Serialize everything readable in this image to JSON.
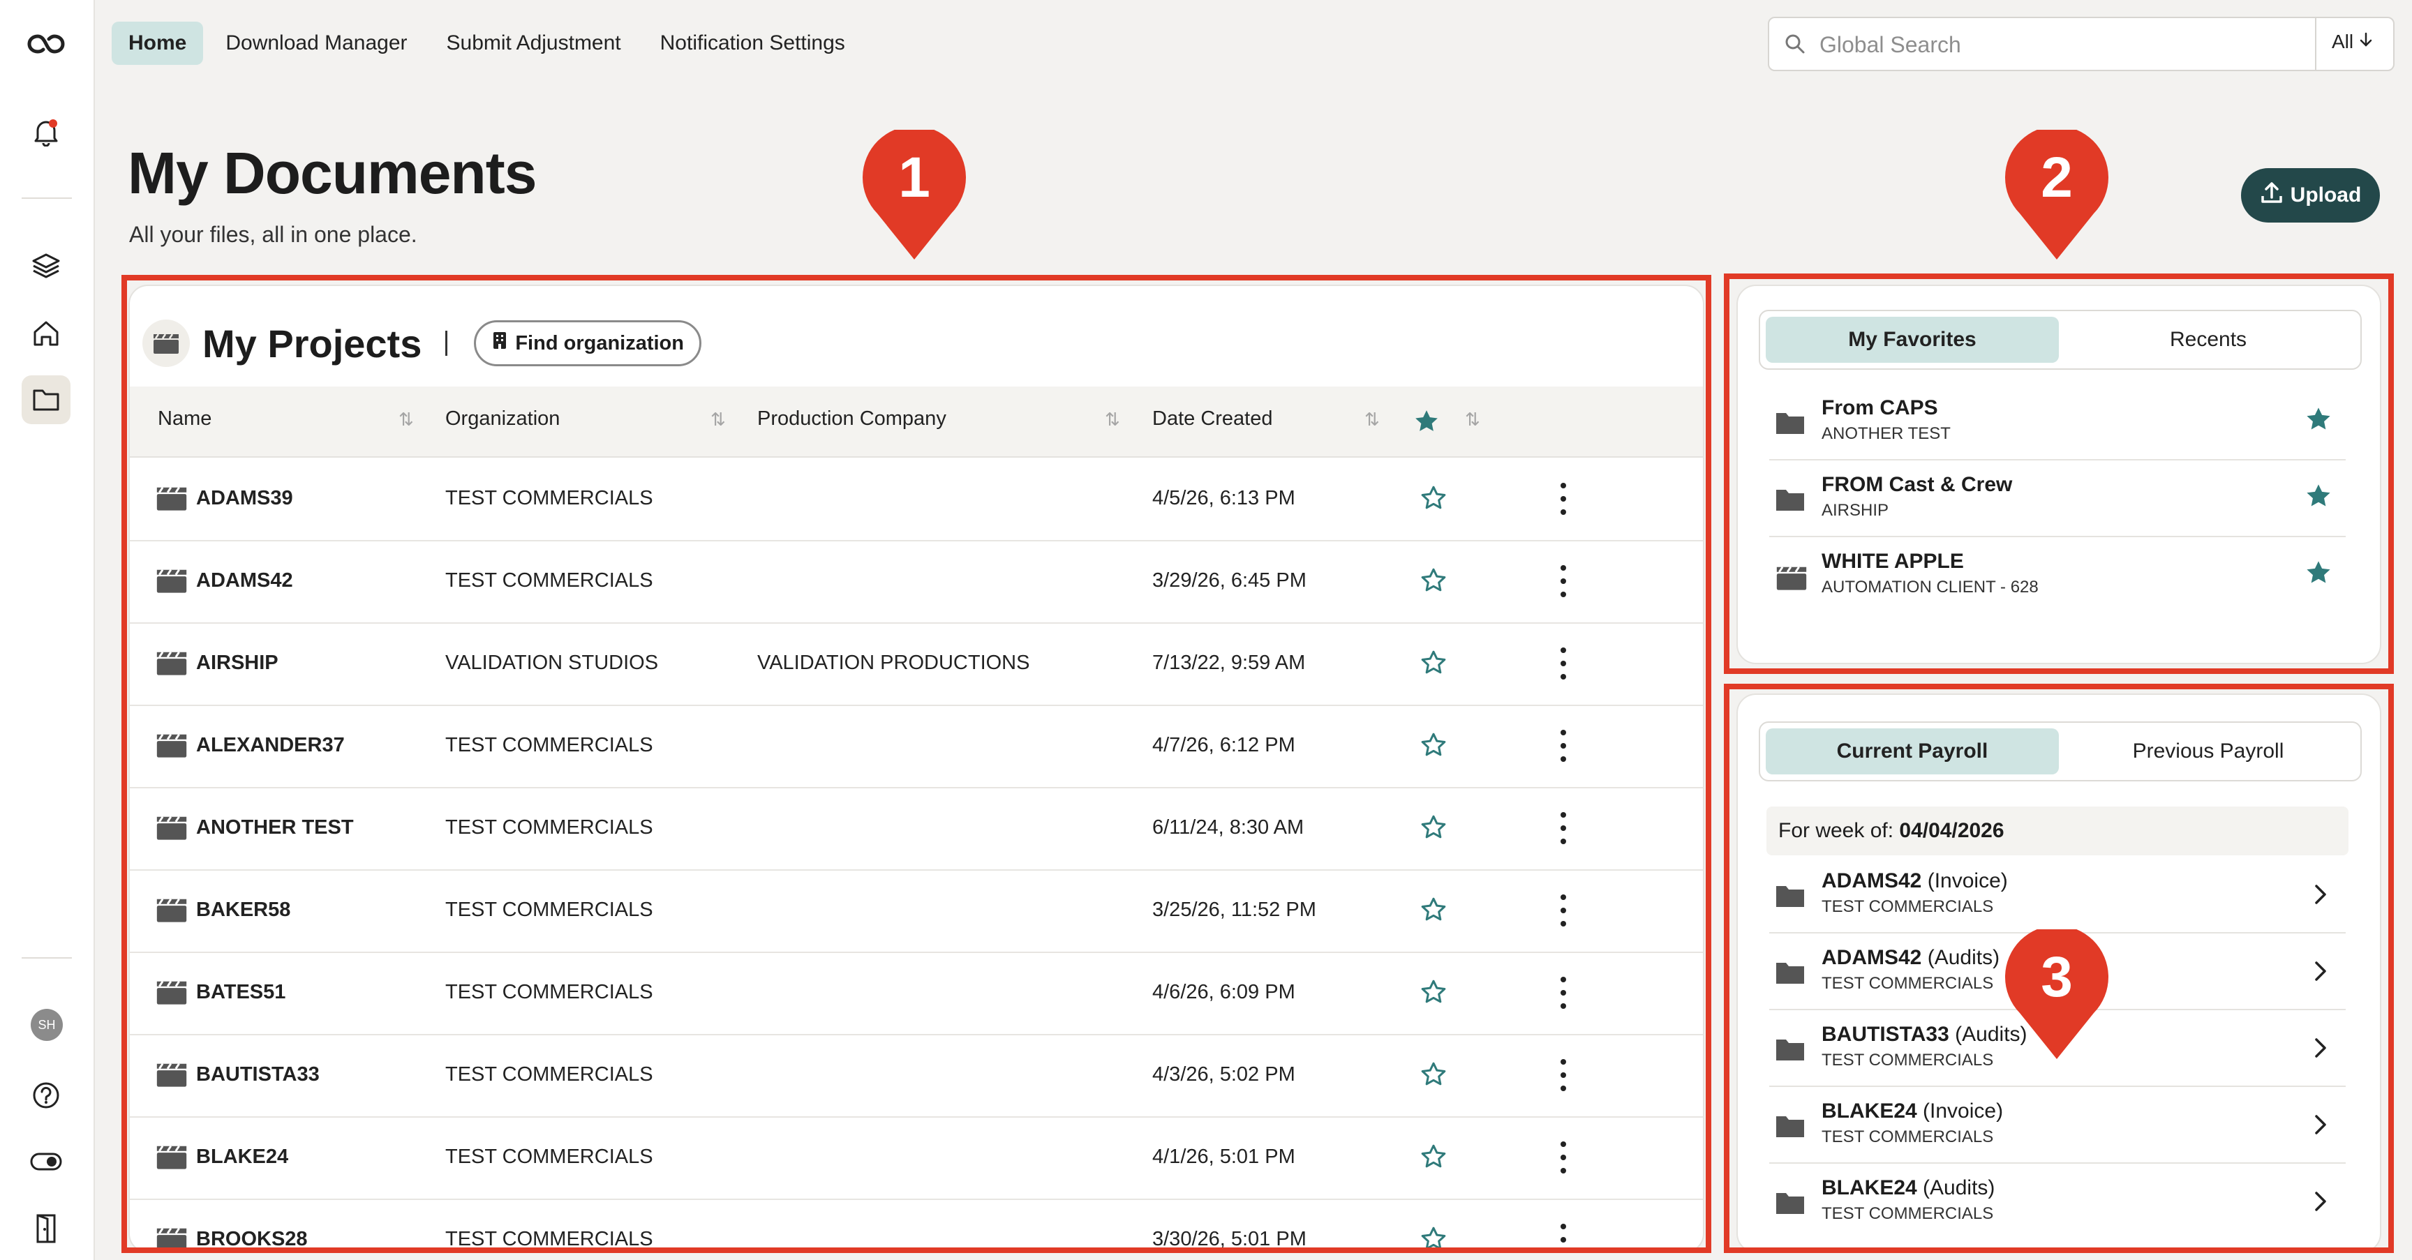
{
  "nav": {
    "items": [
      "Home",
      "Download Manager",
      "Submit Adjustment",
      "Notification Settings"
    ],
    "active": "Home"
  },
  "search": {
    "placeholder": "Global Search",
    "scope": "All"
  },
  "sidebar": {
    "avatar_initials": "SH"
  },
  "page": {
    "title": "My Documents",
    "subtitle": "All your files, all in one place."
  },
  "upload": {
    "label": "Upload"
  },
  "projects": {
    "title": "My Projects",
    "find_label": "Find organization",
    "columns": [
      "Name",
      "Organization",
      "Production Company",
      "Date Created"
    ],
    "rows": [
      {
        "name": "ADAMS39",
        "organization": "TEST COMMERCIALS",
        "company": "",
        "date": "4/5/26, 6:13 PM"
      },
      {
        "name": "ADAMS42",
        "organization": "TEST COMMERCIALS",
        "company": "",
        "date": "3/29/26, 6:45 PM"
      },
      {
        "name": "AIRSHIP",
        "organization": "VALIDATION STUDIOS",
        "company": "VALIDATION PRODUCTIONS",
        "date": "7/13/22, 9:59 AM"
      },
      {
        "name": "ALEXANDER37",
        "organization": "TEST COMMERCIALS",
        "company": "",
        "date": "4/7/26, 6:12 PM"
      },
      {
        "name": "ANOTHER TEST",
        "organization": "TEST COMMERCIALS",
        "company": "",
        "date": "6/11/24, 8:30 AM"
      },
      {
        "name": "BAKER58",
        "organization": "TEST COMMERCIALS",
        "company": "",
        "date": "3/25/26, 11:52 PM"
      },
      {
        "name": "BATES51",
        "organization": "TEST COMMERCIALS",
        "company": "",
        "date": "4/6/26, 6:09 PM"
      },
      {
        "name": "BAUTISTA33",
        "organization": "TEST COMMERCIALS",
        "company": "",
        "date": "4/3/26, 5:02 PM"
      },
      {
        "name": "BLAKE24",
        "organization": "TEST COMMERCIALS",
        "company": "",
        "date": "4/1/26, 5:01 PM"
      },
      {
        "name": "BROOKS28",
        "organization": "TEST COMMERCIALS",
        "company": "",
        "date": "3/30/26, 5:01 PM"
      }
    ]
  },
  "favorites": {
    "tabs": [
      "My Favorites",
      "Recents"
    ],
    "active_tab": "My Favorites",
    "items": [
      {
        "title": "From CAPS",
        "subtitle": "ANOTHER TEST",
        "icon": "folder-icon"
      },
      {
        "title": "FROM Cast & Crew",
        "subtitle": "AIRSHIP",
        "icon": "folder-icon"
      },
      {
        "title": "WHITE APPLE",
        "subtitle": "AUTOMATION CLIENT - 628",
        "icon": "clapperboard-icon"
      }
    ]
  },
  "payroll": {
    "tabs": [
      "Current Payroll",
      "Previous Payroll"
    ],
    "active_tab": "Current Payroll",
    "week_label": "For week of:",
    "week_value": "04/04/2026",
    "items": [
      {
        "title": "ADAMS42",
        "kind": "(Invoice)",
        "subtitle": "TEST COMMERCIALS"
      },
      {
        "title": "ADAMS42",
        "kind": "(Audits)",
        "subtitle": "TEST COMMERCIALS"
      },
      {
        "title": "BAUTISTA33",
        "kind": "(Audits)",
        "subtitle": "TEST COMMERCIALS"
      },
      {
        "title": "BLAKE24",
        "kind": "(Invoice)",
        "subtitle": "TEST COMMERCIALS"
      },
      {
        "title": "BLAKE24",
        "kind": "(Audits)",
        "subtitle": "TEST COMMERCIALS"
      }
    ]
  },
  "markers": [
    "1",
    "2",
    "3"
  ],
  "colors": {
    "accent": "#23484a",
    "teal": "#2f7a7a",
    "highlight_active": "#cfe4e2",
    "annotation_red": "#e13a26"
  }
}
